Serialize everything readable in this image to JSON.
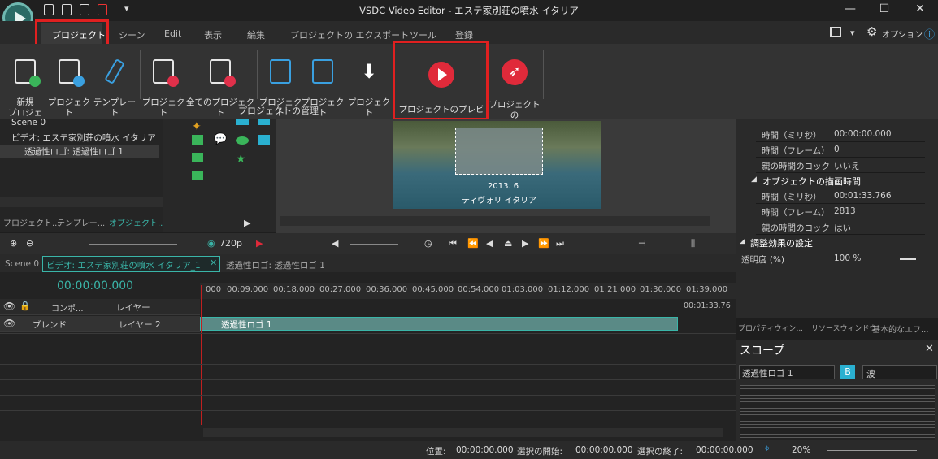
{
  "window": {
    "title": "VSDC Video Editor - エステ家別荘の噴水  イタリア",
    "minimize": "—",
    "maximize": "☐",
    "close": "✕"
  },
  "menu": {
    "items": [
      "プロジェクト",
      "シーン",
      "Edit",
      "表示",
      "編集",
      "プロジェクトの エクスポート",
      "ツール",
      "登録"
    ],
    "options": "オプション",
    "info": "ⓘ"
  },
  "ribbon": {
    "buttons": [
      {
        "label": "新規\nプロジェクト"
      },
      {
        "label": "プロジェクト\nを開く"
      },
      {
        "label": "テンプレート"
      },
      {
        "label": "プロジェクト\nを閉じる"
      },
      {
        "label": "全てのプロジェクト\nを閉じる"
      },
      {
        "label": "プロジェクト\n保存"
      },
      {
        "label": "プロジェクト\n別名保存"
      },
      {
        "label": "プロジェクト\nをパックする"
      },
      {
        "label": "プロジェクトのプレビュー"
      },
      {
        "label": "プロジェクトの\nエクスポート"
      }
    ],
    "group_label": "プロジェクトの管理"
  },
  "explorer": {
    "items": [
      "Scene 0",
      "ビデオ: エステ家別荘の噴水  イタリア",
      "透過性ロゴ: 透過性ロゴ 1"
    ],
    "tabs": [
      "プロジェクト...",
      "テンプレー...",
      "オブジェクト..."
    ]
  },
  "preview": {
    "caption_line1": "2013. 6",
    "caption_line2": "ティヴォリ  イタリア"
  },
  "properties": {
    "rows_a": [
      [
        "時間（ミリ秒）",
        "00:00:00.000"
      ],
      [
        "時間（フレーム）",
        "0"
      ],
      [
        "親の時間のロック",
        "いいえ"
      ]
    ],
    "section_draw": "オブジェクトの描画時間",
    "rows_b": [
      [
        "時間（ミリ秒）",
        "00:01:33.766"
      ],
      [
        "時間（フレーム）",
        "2813"
      ],
      [
        "親の時間のロック",
        "はい"
      ]
    ],
    "section_effect": "調整効果の設定",
    "opacity_label": "透明度 (%)",
    "opacity_value": "100 %",
    "tabs": [
      "プロパティウィン...",
      "リソースウィンドウ",
      "基本的なエフ..."
    ]
  },
  "transport": {
    "resolution": "720p"
  },
  "timeline": {
    "tabs": [
      "Scene 0",
      "ビデオ: エステ家別荘の噴水  イタリア_1",
      "透過性ロゴ: 透過性ロゴ 1"
    ],
    "timecode": "00:00:00.000",
    "ruler": [
      "000",
      "00:09.000",
      "00:18.000",
      "00:27.000",
      "00:36.000",
      "00:45.000",
      "00:54.000",
      "01:03.000",
      "01:12.000",
      "01:21.000",
      "01:30.000",
      "01:39.000"
    ],
    "end_time": "00:01:33.76",
    "header1": {
      "composition": "コンポ...",
      "layer": "レイヤー"
    },
    "header2": {
      "blend": "ブレンド",
      "layer": "レイヤー 2"
    },
    "clip_label": "透過性ロゴ 1"
  },
  "scope": {
    "title": "スコープ",
    "source": "透過性ロゴ 1",
    "mode": "波",
    "b": "B"
  },
  "status": {
    "position_label": "位置:",
    "position": "00:00:00.000",
    "sel_start_label": "選択の開始:",
    "sel_start": "00:00:00.000",
    "sel_end_label": "選択の終了:",
    "sel_end": "00:00:00.000",
    "zoom": "20%"
  },
  "colors": {
    "accent": "#3ab5a8",
    "highlight": "#e02020",
    "play_red": "#e02a3a"
  }
}
